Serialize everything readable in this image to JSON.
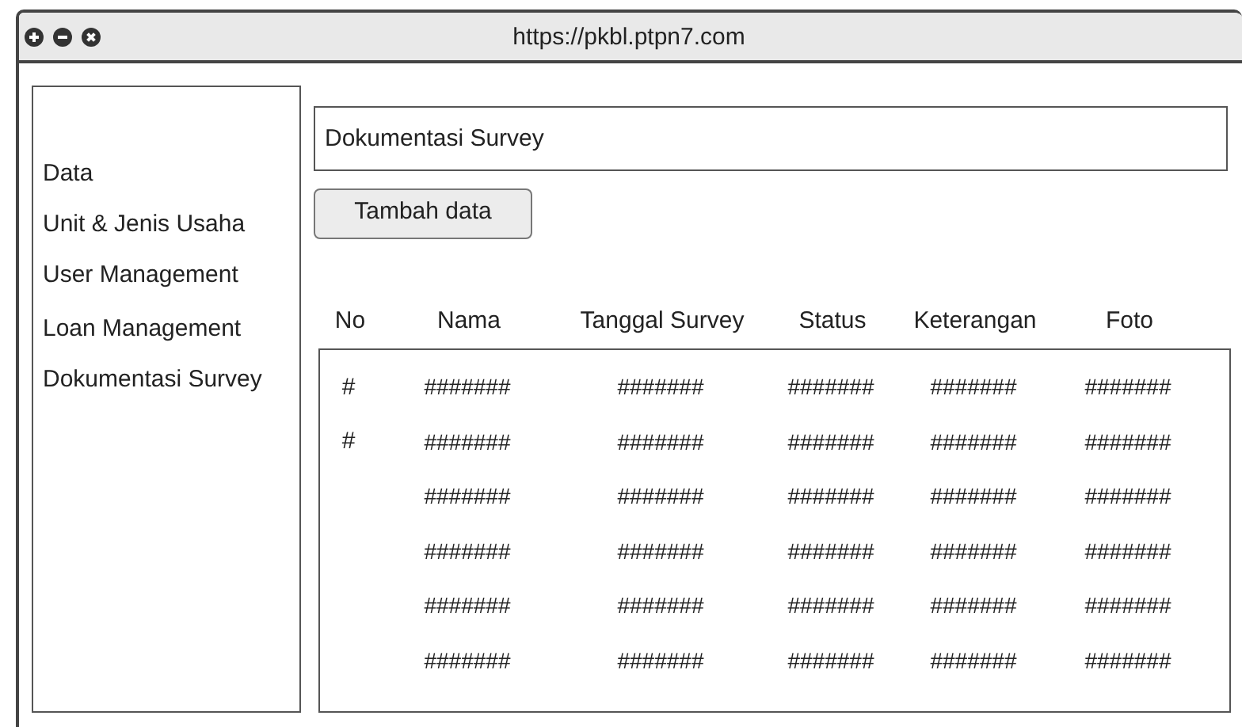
{
  "window": {
    "url": "https://pkbl.ptpn7.com"
  },
  "sidebar": {
    "items": [
      {
        "label": "Data"
      },
      {
        "label": "Unit & Jenis Usaha"
      },
      {
        "label": "User Management"
      },
      {
        "label": "Loan Management"
      },
      {
        "label": "Dokumentasi Survey"
      }
    ]
  },
  "page_title": "Dokumentasi Survey",
  "add_button": "Tambah data",
  "table": {
    "columns": [
      "No",
      "Nama",
      "Tanggal Survey",
      "Status",
      "Keterangan",
      "Foto"
    ],
    "rows": [
      {
        "cells": [
          "#",
          "#######",
          "#######",
          "#######",
          "#######",
          "#######"
        ]
      },
      {
        "cells": [
          "#",
          "#######",
          "#######",
          "#######",
          "#######",
          "#######"
        ]
      },
      {
        "cells": [
          "",
          "#######",
          "#######",
          "#######",
          "#######",
          "#######"
        ]
      },
      {
        "cells": [
          "",
          "#######",
          "#######",
          "#######",
          "#######",
          "#######"
        ]
      },
      {
        "cells": [
          "",
          "#######",
          "#######",
          "#######",
          "#######",
          "#######"
        ]
      },
      {
        "cells": [
          "",
          "#######",
          "#######",
          "#######",
          "#######",
          "#######"
        ]
      }
    ]
  }
}
